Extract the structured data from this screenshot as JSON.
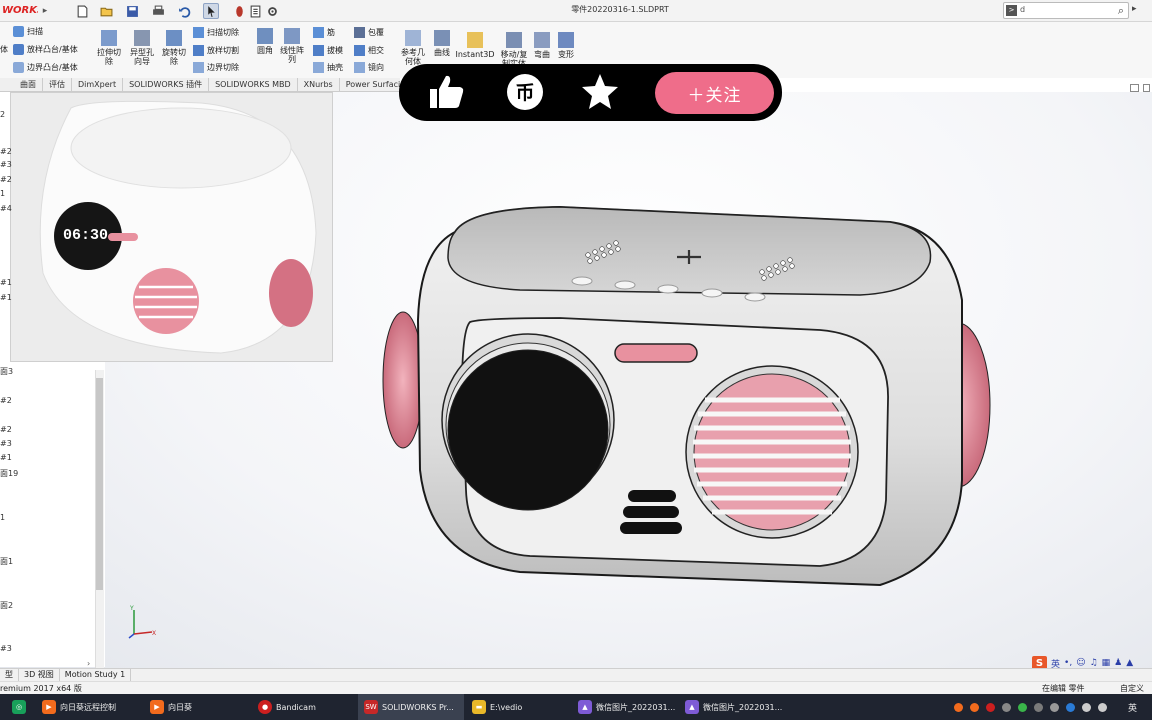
{
  "titlebar": {
    "app_logo": "WORKS",
    "document_title": "零件20220316-1.SLDPRT",
    "search_value": "d"
  },
  "ribbon": {
    "left_group": {
      "label_top": "体",
      "items": [
        "扫描",
        "放样凸台/基体",
        "边界凸台/基体"
      ]
    },
    "cut_buttons": [
      "拉伸切除",
      "异型孔向导",
      "旋转切除"
    ],
    "cut_small": [
      "扫描切除",
      "放样切割",
      "边界切除"
    ],
    "feature_buttons": [
      "圆角",
      "线性阵列"
    ],
    "feature_small_a": [
      "筋",
      "拔模",
      "抽壳"
    ],
    "feature_small_b": [
      "包覆",
      "相交",
      "镜向"
    ],
    "ref_buttons": [
      "参考几何体",
      "曲线",
      "Instant3D"
    ],
    "move_buttons": [
      "移动/复制实体",
      "弯曲",
      "变形"
    ]
  },
  "tabs": [
    "曲面",
    "评估",
    "DimXpert",
    "SOLIDWORKS 插件",
    "SOLIDWORKS MBD",
    "XNurbs",
    "Power Surfacing",
    "P"
  ],
  "overlay": {
    "like_icon": "thumbs-up",
    "coin_icon": "coin",
    "coin_char": "币",
    "star_icon": "star",
    "follow_label": "＋关注"
  },
  "tree": {
    "side_items": [
      "2",
      "#2",
      "#3",
      "#2",
      "1",
      "#4",
      "#1",
      "#1"
    ],
    "items": [
      "面3",
      "#2",
      "#2",
      "#3",
      "#1",
      "面19",
      "1",
      "面1",
      "面2",
      "#3"
    ]
  },
  "bottom_tabs": [
    "型",
    "3D 视图",
    "Motion Study 1"
  ],
  "status": {
    "left": "remium 2017 x64 版",
    "editing": "在编辑 零件",
    "custom": "自定义"
  },
  "ime": {
    "logo": "S",
    "lang": "英"
  },
  "taskbar": {
    "apps": [
      {
        "label": "向日葵远程控制",
        "color": "#f26b1d"
      },
      {
        "label": "向日葵",
        "color": "#f26b1d"
      },
      {
        "label": "Bandicam",
        "color": "#cc1f1f"
      },
      {
        "label": "SOLIDWORKS Pr...",
        "color": "#c62828"
      },
      {
        "label": "E:\\vedio",
        "color": "#e8b829"
      },
      {
        "label": "微信图片_2022031...",
        "color": "#7e5bd6"
      },
      {
        "label": "微信图片_2022031...",
        "color": "#7e5bd6"
      }
    ],
    "tray_lang": "英"
  },
  "product_render": {
    "clock_text": "06:30"
  },
  "colors": {
    "accent_pink": "#ef6d8a",
    "speaker_pink": "#e8919f",
    "overlay_bg": "#000000",
    "taskbar_bg": "#1f2430"
  }
}
